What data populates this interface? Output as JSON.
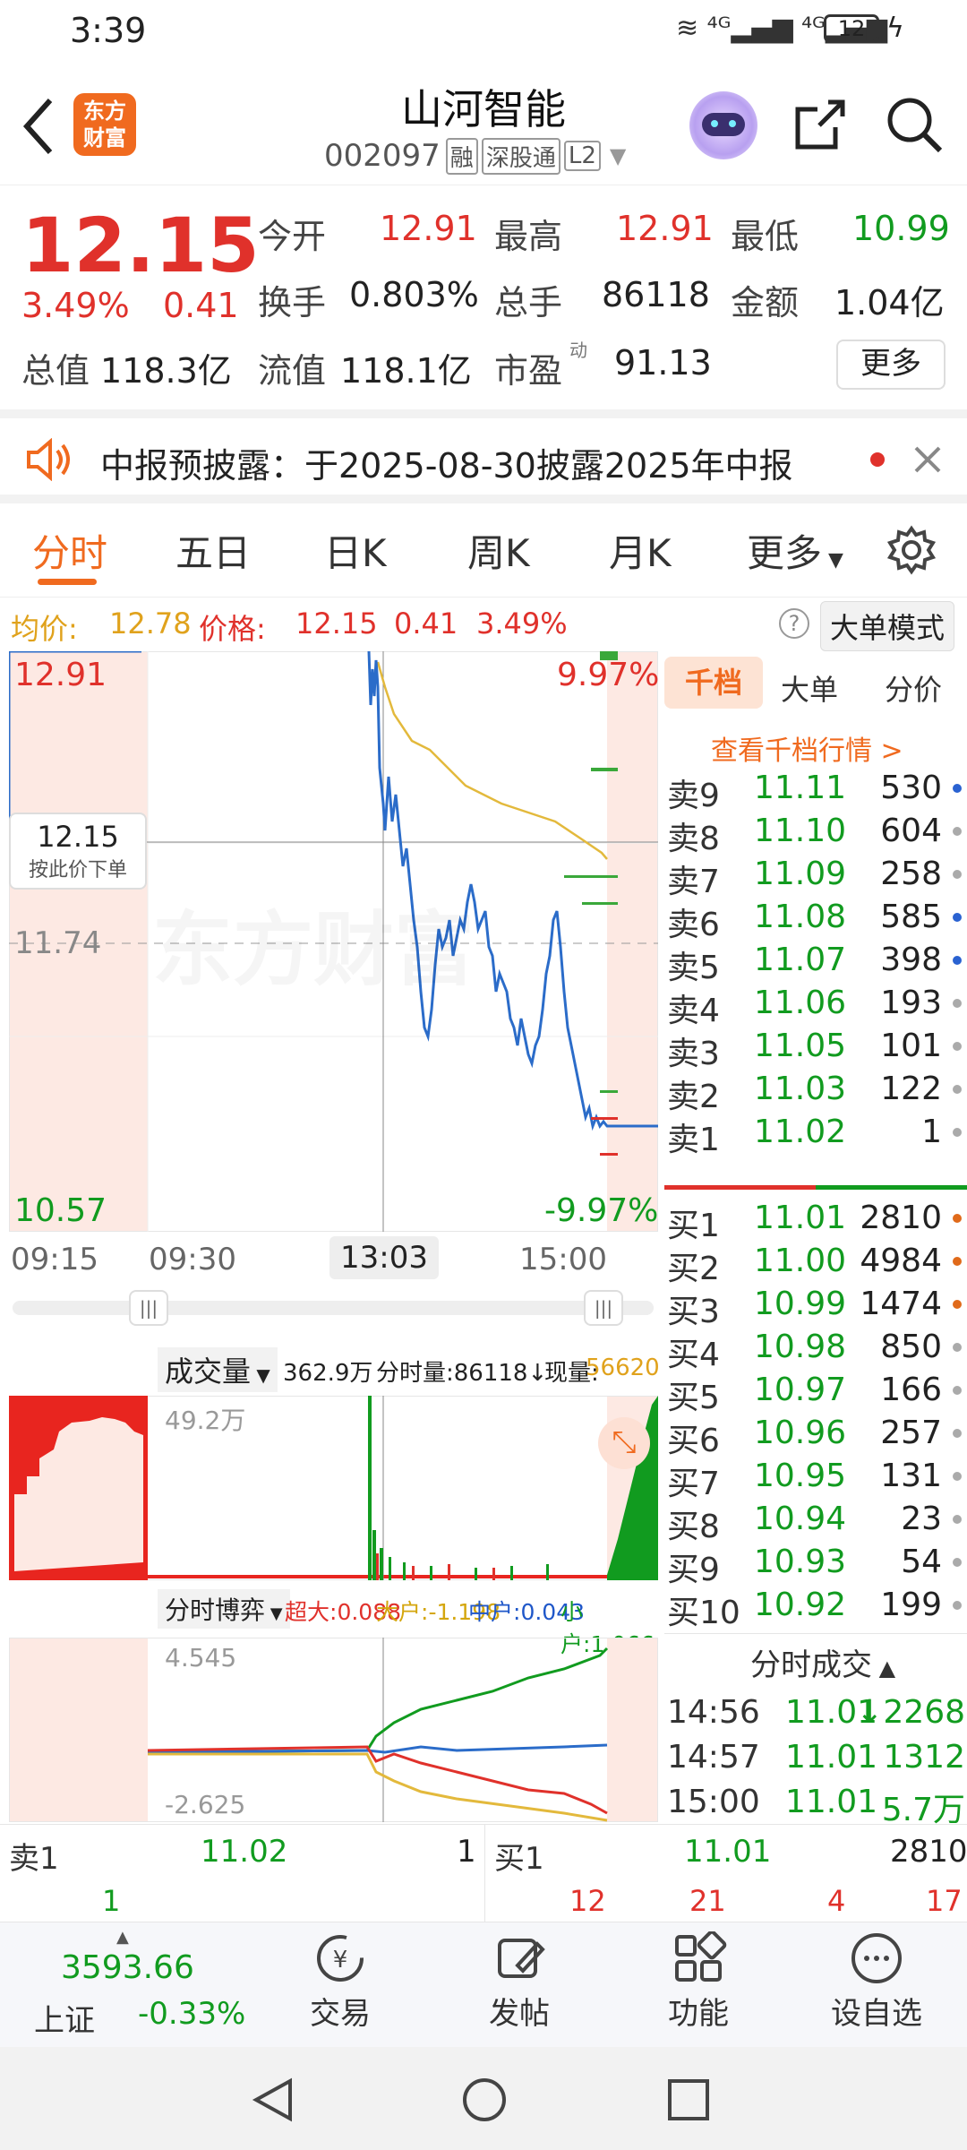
{
  "status_bar": {
    "time": "3:39",
    "battery": "12"
  },
  "header": {
    "logo_text_1": "东方",
    "logo_text_2": "财富",
    "stock_name": "山河智能",
    "stock_code": "002097",
    "badges": [
      "融",
      "深股通",
      "L2"
    ]
  },
  "quote": {
    "price": "12.15",
    "change_pct": "3.49%",
    "change": "0.41",
    "open_label": "今开",
    "open": "12.91",
    "high_label": "最高",
    "high": "12.91",
    "low_label": "最低",
    "low": "10.99",
    "turnover_label": "换手",
    "turnover": "0.803%",
    "volume_label": "总手",
    "volume": "86118",
    "amount_label": "金额",
    "amount": "1.04亿",
    "mktcap_label": "总值",
    "mktcap": "118.3亿",
    "float_label": "流值",
    "float_cap": "118.1亿",
    "pe_label": "市盈",
    "pe_sup": "动",
    "pe": "91.13",
    "more_button": "更多"
  },
  "notice": {
    "text": "中报预披露：于2025-08-30披露2025年中报"
  },
  "tabs": [
    "分时",
    "五日",
    "日K",
    "周K",
    "月K",
    "更多"
  ],
  "info_line": {
    "avg_label": "均价:",
    "avg": "12.78",
    "price_label": "价格:",
    "price": "12.15",
    "change": "0.41",
    "pct": "3.49%",
    "mode_button": "大单模式"
  },
  "chart": {
    "top_price": "12.91",
    "top_pct": "9.97%",
    "bottom_price": "10.57",
    "bottom_pct": "-9.97%",
    "mid_price": "11.74",
    "cursor_price": "12.15",
    "cursor_hint": "按此价下单",
    "time_start": "09:15",
    "time_open": "09:30",
    "time_cursor": "13:03",
    "time_end": "15:00",
    "watermark": "东方财富"
  },
  "volume": {
    "selector": "成交量",
    "total": "362.9万",
    "tick_label": "分时量:86118↓",
    "now_label": "现量:",
    "now": "56620",
    "max": "49.2万"
  },
  "flow": {
    "selector": "分时博弈",
    "super_label": "超大:",
    "super": "0.088",
    "big_label": "大户:",
    "big": "-1.198",
    "mid_label": "中户:",
    "mid": "0.043",
    "small_label": "小户:",
    "small": "1.066",
    "max": "4.545",
    "min": "-2.625"
  },
  "orderbook": {
    "tabs": [
      "千档",
      "大单",
      "分价"
    ],
    "link": "查看千档行情 >",
    "asks": [
      {
        "label": "卖9",
        "price": "11.11",
        "vol": "530",
        "dot": "#2a62d1"
      },
      {
        "label": "卖8",
        "price": "11.10",
        "vol": "604",
        "dot": "#aaaaaa"
      },
      {
        "label": "卖7",
        "price": "11.09",
        "vol": "258",
        "dot": "#aaaaaa"
      },
      {
        "label": "卖6",
        "price": "11.08",
        "vol": "585",
        "dot": "#2a62d1"
      },
      {
        "label": "卖5",
        "price": "11.07",
        "vol": "398",
        "dot": "#2a62d1"
      },
      {
        "label": "卖4",
        "price": "11.06",
        "vol": "193",
        "dot": "#aaaaaa"
      },
      {
        "label": "卖3",
        "price": "11.05",
        "vol": "101",
        "dot": "#aaaaaa"
      },
      {
        "label": "卖2",
        "price": "11.03",
        "vol": "122",
        "dot": "#aaaaaa"
      },
      {
        "label": "卖1",
        "price": "11.02",
        "vol": "1",
        "dot": "#aaaaaa"
      }
    ],
    "bids": [
      {
        "label": "买1",
        "price": "11.01",
        "vol": "2810",
        "dot": "#e06a1a"
      },
      {
        "label": "买2",
        "price": "11.00",
        "vol": "4984",
        "dot": "#e06a1a"
      },
      {
        "label": "买3",
        "price": "10.99",
        "vol": "1474",
        "dot": "#e06a1a"
      },
      {
        "label": "买4",
        "price": "10.98",
        "vol": "850",
        "dot": "#aaaaaa"
      },
      {
        "label": "买5",
        "price": "10.97",
        "vol": "166",
        "dot": "#aaaaaa"
      },
      {
        "label": "买6",
        "price": "10.96",
        "vol": "257",
        "dot": "#aaaaaa"
      },
      {
        "label": "买7",
        "price": "10.95",
        "vol": "131",
        "dot": "#aaaaaa"
      },
      {
        "label": "买8",
        "price": "10.94",
        "vol": "23",
        "dot": "#aaaaaa"
      },
      {
        "label": "买9",
        "price": "10.93",
        "vol": "54",
        "dot": "#aaaaaa"
      },
      {
        "label": "买10",
        "price": "10.92",
        "vol": "199",
        "dot": "#aaaaaa"
      }
    ],
    "trades_title": "分时成交",
    "trades": [
      {
        "time": "14:56",
        "price": "11.01",
        "vol": "↓2268"
      },
      {
        "time": "14:57",
        "price": "11.01",
        "vol": "1312"
      },
      {
        "time": "15:00",
        "price": "11.01",
        "vol": "5.7万"
      }
    ]
  },
  "level1": {
    "ask_label": "卖1",
    "ask_price": "11.02",
    "ask_vol": "1",
    "bid_label": "买1",
    "bid_price": "11.01",
    "bid_vol": "2810",
    "ask_count": "1",
    "bid_counts": [
      "12",
      "21",
      "4",
      "17"
    ]
  },
  "bottom_bar": {
    "index_value": "3593.66",
    "index_name": "上证",
    "index_change": "-0.33%",
    "items": [
      "交易",
      "发帖",
      "功能",
      "设自选"
    ]
  }
}
